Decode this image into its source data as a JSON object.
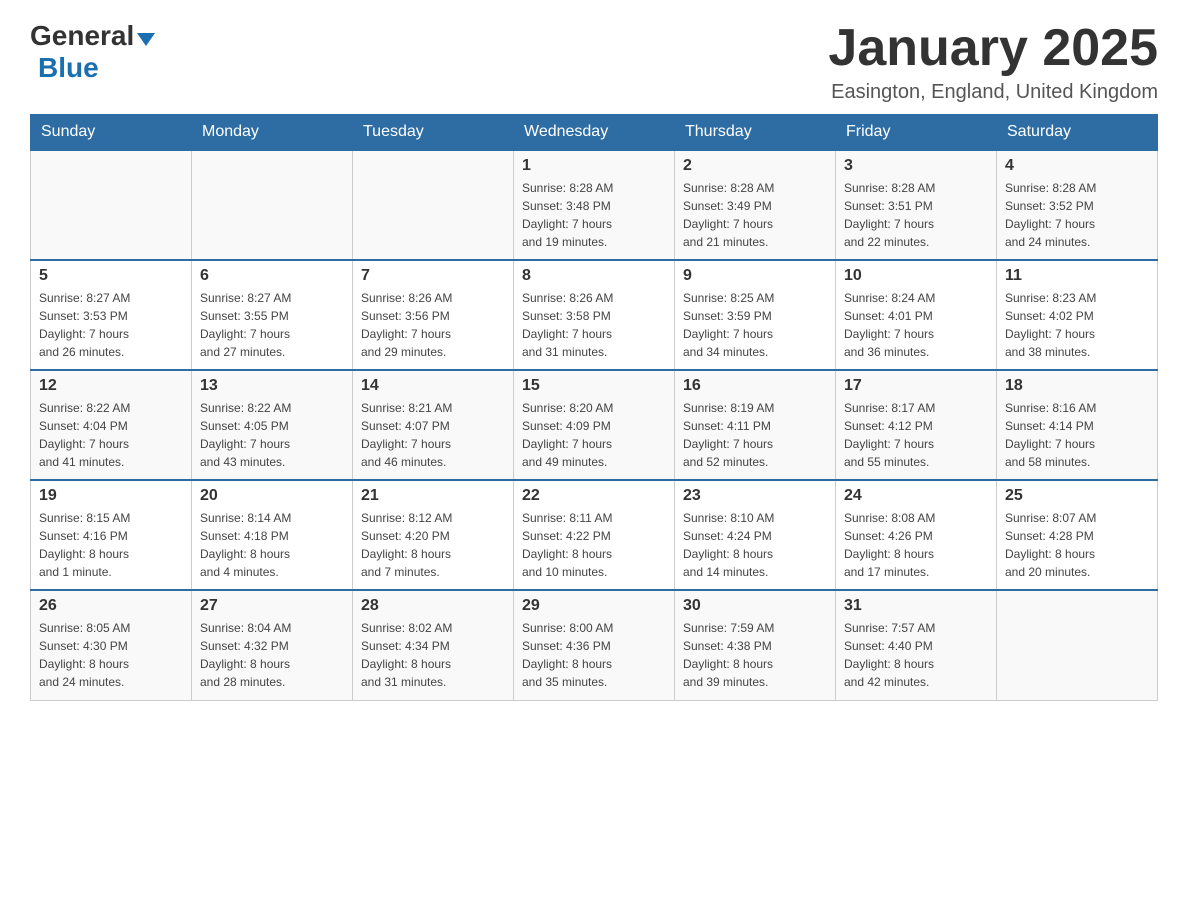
{
  "logo": {
    "general": "General",
    "blue": "Blue"
  },
  "header": {
    "title": "January 2025",
    "location": "Easington, England, United Kingdom"
  },
  "days_of_week": [
    "Sunday",
    "Monday",
    "Tuesday",
    "Wednesday",
    "Thursday",
    "Friday",
    "Saturday"
  ],
  "weeks": [
    [
      {
        "day": "",
        "info": ""
      },
      {
        "day": "",
        "info": ""
      },
      {
        "day": "",
        "info": ""
      },
      {
        "day": "1",
        "info": "Sunrise: 8:28 AM\nSunset: 3:48 PM\nDaylight: 7 hours\nand 19 minutes."
      },
      {
        "day": "2",
        "info": "Sunrise: 8:28 AM\nSunset: 3:49 PM\nDaylight: 7 hours\nand 21 minutes."
      },
      {
        "day": "3",
        "info": "Sunrise: 8:28 AM\nSunset: 3:51 PM\nDaylight: 7 hours\nand 22 minutes."
      },
      {
        "day": "4",
        "info": "Sunrise: 8:28 AM\nSunset: 3:52 PM\nDaylight: 7 hours\nand 24 minutes."
      }
    ],
    [
      {
        "day": "5",
        "info": "Sunrise: 8:27 AM\nSunset: 3:53 PM\nDaylight: 7 hours\nand 26 minutes."
      },
      {
        "day": "6",
        "info": "Sunrise: 8:27 AM\nSunset: 3:55 PM\nDaylight: 7 hours\nand 27 minutes."
      },
      {
        "day": "7",
        "info": "Sunrise: 8:26 AM\nSunset: 3:56 PM\nDaylight: 7 hours\nand 29 minutes."
      },
      {
        "day": "8",
        "info": "Sunrise: 8:26 AM\nSunset: 3:58 PM\nDaylight: 7 hours\nand 31 minutes."
      },
      {
        "day": "9",
        "info": "Sunrise: 8:25 AM\nSunset: 3:59 PM\nDaylight: 7 hours\nand 34 minutes."
      },
      {
        "day": "10",
        "info": "Sunrise: 8:24 AM\nSunset: 4:01 PM\nDaylight: 7 hours\nand 36 minutes."
      },
      {
        "day": "11",
        "info": "Sunrise: 8:23 AM\nSunset: 4:02 PM\nDaylight: 7 hours\nand 38 minutes."
      }
    ],
    [
      {
        "day": "12",
        "info": "Sunrise: 8:22 AM\nSunset: 4:04 PM\nDaylight: 7 hours\nand 41 minutes."
      },
      {
        "day": "13",
        "info": "Sunrise: 8:22 AM\nSunset: 4:05 PM\nDaylight: 7 hours\nand 43 minutes."
      },
      {
        "day": "14",
        "info": "Sunrise: 8:21 AM\nSunset: 4:07 PM\nDaylight: 7 hours\nand 46 minutes."
      },
      {
        "day": "15",
        "info": "Sunrise: 8:20 AM\nSunset: 4:09 PM\nDaylight: 7 hours\nand 49 minutes."
      },
      {
        "day": "16",
        "info": "Sunrise: 8:19 AM\nSunset: 4:11 PM\nDaylight: 7 hours\nand 52 minutes."
      },
      {
        "day": "17",
        "info": "Sunrise: 8:17 AM\nSunset: 4:12 PM\nDaylight: 7 hours\nand 55 minutes."
      },
      {
        "day": "18",
        "info": "Sunrise: 8:16 AM\nSunset: 4:14 PM\nDaylight: 7 hours\nand 58 minutes."
      }
    ],
    [
      {
        "day": "19",
        "info": "Sunrise: 8:15 AM\nSunset: 4:16 PM\nDaylight: 8 hours\nand 1 minute."
      },
      {
        "day": "20",
        "info": "Sunrise: 8:14 AM\nSunset: 4:18 PM\nDaylight: 8 hours\nand 4 minutes."
      },
      {
        "day": "21",
        "info": "Sunrise: 8:12 AM\nSunset: 4:20 PM\nDaylight: 8 hours\nand 7 minutes."
      },
      {
        "day": "22",
        "info": "Sunrise: 8:11 AM\nSunset: 4:22 PM\nDaylight: 8 hours\nand 10 minutes."
      },
      {
        "day": "23",
        "info": "Sunrise: 8:10 AM\nSunset: 4:24 PM\nDaylight: 8 hours\nand 14 minutes."
      },
      {
        "day": "24",
        "info": "Sunrise: 8:08 AM\nSunset: 4:26 PM\nDaylight: 8 hours\nand 17 minutes."
      },
      {
        "day": "25",
        "info": "Sunrise: 8:07 AM\nSunset: 4:28 PM\nDaylight: 8 hours\nand 20 minutes."
      }
    ],
    [
      {
        "day": "26",
        "info": "Sunrise: 8:05 AM\nSunset: 4:30 PM\nDaylight: 8 hours\nand 24 minutes."
      },
      {
        "day": "27",
        "info": "Sunrise: 8:04 AM\nSunset: 4:32 PM\nDaylight: 8 hours\nand 28 minutes."
      },
      {
        "day": "28",
        "info": "Sunrise: 8:02 AM\nSunset: 4:34 PM\nDaylight: 8 hours\nand 31 minutes."
      },
      {
        "day": "29",
        "info": "Sunrise: 8:00 AM\nSunset: 4:36 PM\nDaylight: 8 hours\nand 35 minutes."
      },
      {
        "day": "30",
        "info": "Sunrise: 7:59 AM\nSunset: 4:38 PM\nDaylight: 8 hours\nand 39 minutes."
      },
      {
        "day": "31",
        "info": "Sunrise: 7:57 AM\nSunset: 4:40 PM\nDaylight: 8 hours\nand 42 minutes."
      },
      {
        "day": "",
        "info": ""
      }
    ]
  ]
}
